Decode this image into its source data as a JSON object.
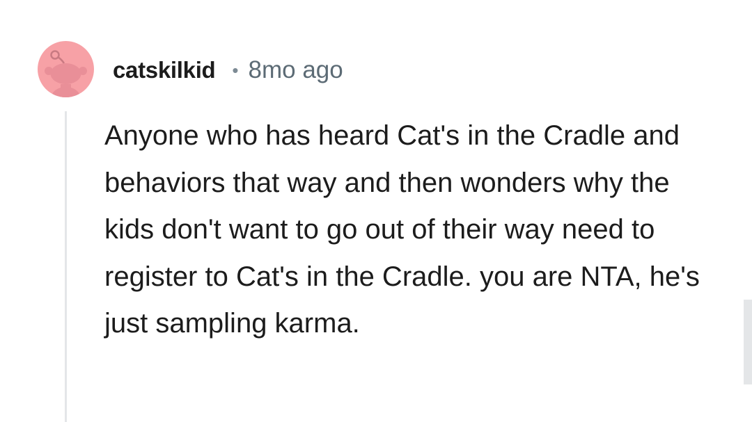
{
  "comment": {
    "username": "catskilkid",
    "separator": "•",
    "timestamp": "8mo ago",
    "avatar_icon": "reddit-snoo-avatar-icon",
    "avatar_color": "#f7a1a6",
    "body": "Anyone who has heard Cat's in the Cradle and behaviors that way and then wonders why the kids don't want to go out of their way need to register to Cat's in the Cradle. you are NTA, he's just sampling karma."
  }
}
